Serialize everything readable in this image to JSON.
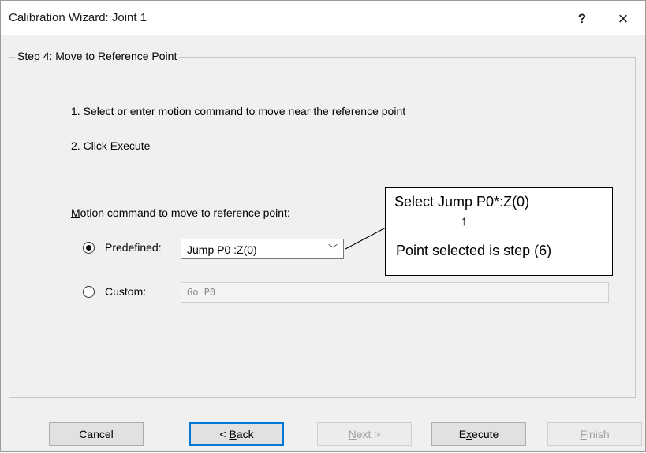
{
  "window": {
    "title": "Calibration Wizard: Joint 1",
    "help_label": "?",
    "close_label": "×"
  },
  "step": {
    "legend": "Step 4: Move to Reference Point",
    "instructions": [
      "1. Select or enter motion command to move near the reference point",
      "2. Click Execute"
    ]
  },
  "motion": {
    "label_accesskey": "M",
    "label_rest": "otion command to move to reference point:",
    "predefined": {
      "label": "Predefined:",
      "selected": true,
      "value": "Jump P0 :Z(0)",
      "arrow": "﹀"
    },
    "custom": {
      "label": "Custom:",
      "selected": false,
      "value": "Go P0"
    }
  },
  "callout": {
    "line1": "Select Jump P0*:Z(0)",
    "arrow": "↑",
    "line2": "Point selected is step (6)"
  },
  "buttons": {
    "cancel": "Cancel",
    "back_prefix": "< ",
    "back_accesskey": "B",
    "back_rest": "ack",
    "next_accesskey": "N",
    "next_rest": "ext >",
    "execute_prefix": "E",
    "execute_accesskey": "x",
    "execute_rest": "ecute",
    "finish_accesskey": "F",
    "finish_rest": "inish"
  }
}
